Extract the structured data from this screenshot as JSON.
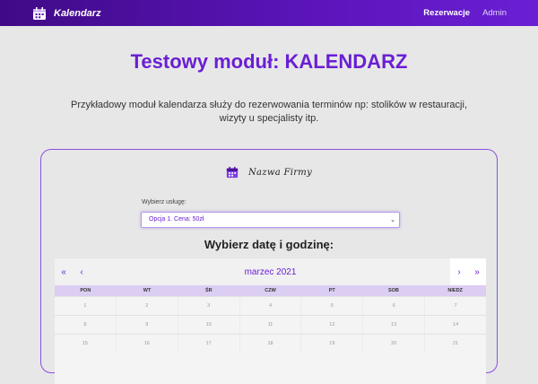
{
  "navbar": {
    "brand": "Kalendarz",
    "brand_icon": "calendar-icon",
    "links": [
      "Rezerwacje",
      "Admin"
    ]
  },
  "page": {
    "title": "Testowy moduł: KALENDARZ",
    "description": "Przykładowy moduł kalendarza służy do rezerwowania terminów np: stolików w restauracji, wizyty u specjalisty itp."
  },
  "card": {
    "firm_name": "Nazwa Firmy",
    "firm_icon": "calendar-icon",
    "service_label": "Wybierz usługę:",
    "service_selected": "Opcja 1. Cena: 50zł",
    "choose_title": "Wybierz datę i godzinę:"
  },
  "calendar": {
    "month": "marzec 2021",
    "prev_year": "«",
    "prev_month": "‹",
    "next_month": "›",
    "next_year": "»",
    "days": [
      "PON",
      "WT",
      "ŚR",
      "CZW",
      "PT",
      "SOB",
      "NIEDZ"
    ],
    "weeks": [
      [
        "1",
        "2",
        "3",
        "4",
        "5",
        "6",
        "7"
      ],
      [
        "8",
        "9",
        "10",
        "11",
        "12",
        "13",
        "14"
      ],
      [
        "15",
        "16",
        "17",
        "18",
        "19",
        "20",
        "21"
      ]
    ]
  },
  "colors": {
    "accent": "#6a1fd4",
    "nav_start": "#3f0a86",
    "nav_end": "#6a1fd4",
    "day_header": "#dccdf3"
  }
}
